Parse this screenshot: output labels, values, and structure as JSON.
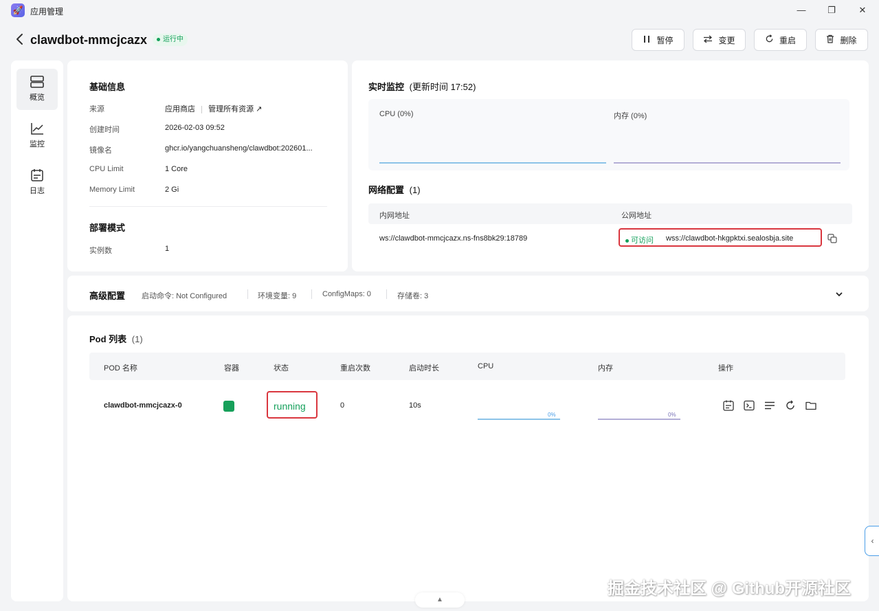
{
  "window": {
    "title": "应用管理",
    "minimize_glyph": "—",
    "maximize_glyph": "❐",
    "close_glyph": "✕"
  },
  "header": {
    "app_name": "clawdbot-mmcjcazx",
    "status": "运行中",
    "buttons": {
      "pause": "暂停",
      "change": "变更",
      "restart": "重启",
      "delete": "删除"
    }
  },
  "sidebar": {
    "items": [
      {
        "label": "概览",
        "icon": "overview-icon"
      },
      {
        "label": "监控",
        "icon": "chart-icon"
      },
      {
        "label": "日志",
        "icon": "log-icon"
      }
    ]
  },
  "basic_info": {
    "title": "基础信息",
    "source_label": "来源",
    "source_value": "应用商店",
    "manage_link": "管理所有资源 ↗",
    "created_label": "创建时间",
    "created_value": "2026-02-03 09:52",
    "image_label": "镜像名",
    "image_value": "ghcr.io/yangchuansheng/clawdbot:202601...",
    "cpu_label": "CPU Limit",
    "cpu_value": "1 Core",
    "memory_label": "Memory Limit",
    "memory_value": "2 Gi",
    "deploy_title": "部署模式",
    "instances_label": "实例数",
    "instances_value": "1"
  },
  "monitor": {
    "title": "实时监控",
    "update_time": "(更新时间  17:52)",
    "cpu_label": "CPU  (0%)",
    "memory_label": "内存  (0%)",
    "cpu_color": "#8cc3e8",
    "memory_color": "#b3aed6"
  },
  "network": {
    "title": "网络配置",
    "count": "(1)",
    "internal_header": "内网地址",
    "public_header": "公网地址",
    "internal_address": "ws://clawdbot-mmcjcazx.ns-fns8bk29:18789",
    "accessible_badge": "可访问",
    "public_address": "wss://clawdbot-hkgpktxi.sealosbja.site"
  },
  "advanced": {
    "title": "高级配置",
    "start_cmd": "启动命令: Not Configured",
    "env": "环境变量: 9",
    "configmaps": "ConfigMaps: 0",
    "storage": "存储卷: 3"
  },
  "pods": {
    "title": "Pod 列表",
    "count": "(1)",
    "headers": [
      "POD 名称",
      "容器",
      "状态",
      "重启次数",
      "启动时长",
      "CPU",
      "内存",
      "操作"
    ],
    "rows": [
      {
        "name": "clawdbot-mmcjcazx-0",
        "container_color": "#17a05a",
        "status": "running",
        "restarts": "0",
        "uptime": "10s",
        "cpu_pct": "0%",
        "mem_pct": "0%"
      }
    ],
    "row_cpu": 0,
    "row_mem": 0
  },
  "watermark": "掘金技术社区 @ Github开源社区"
}
